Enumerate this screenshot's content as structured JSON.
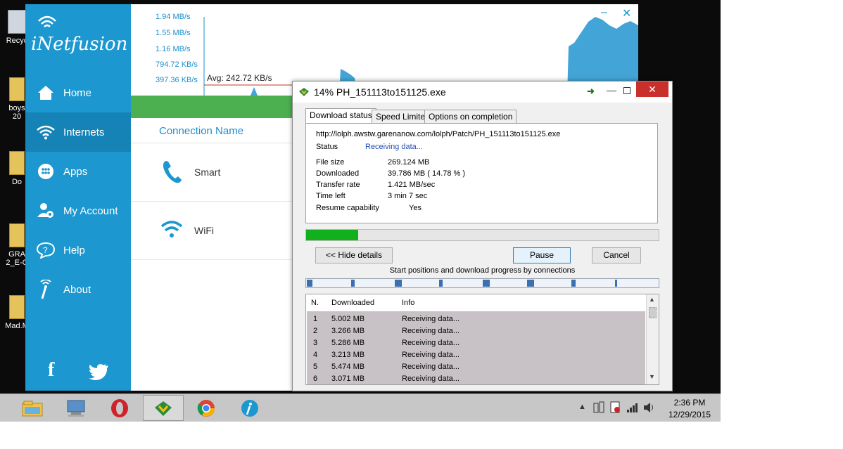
{
  "desktop": {
    "icons": [
      {
        "label": "Recyc",
        "type": "bin"
      },
      {
        "label": "boys\n20",
        "type": "folder"
      },
      {
        "label": "Do",
        "type": "folder"
      },
      {
        "label": "GRA\n2_E-C",
        "type": "folder"
      },
      {
        "label": "Mad.M",
        "type": "folder"
      }
    ]
  },
  "inetfusion": {
    "brand": "iNetfusion",
    "nav": [
      {
        "label": "Home",
        "icon": "home-icon"
      },
      {
        "label": "Internets",
        "icon": "wifi-icon",
        "active": true
      },
      {
        "label": "Apps",
        "icon": "apps-icon"
      },
      {
        "label": "My Account",
        "icon": "account-icon"
      },
      {
        "label": "Help",
        "icon": "help-icon"
      },
      {
        "label": "About",
        "icon": "about-icon"
      }
    ],
    "graph": {
      "y_ticks": [
        "1.94 MB/s",
        "1.55 MB/s",
        "1.16 MB/s",
        "794.72 KB/s",
        "397.36 KB/s"
      ],
      "avg_label": "Avg: 242.72 KB/s"
    },
    "controls": {
      "minimize": "–",
      "close": "✕"
    },
    "connection_header": "Connection Name",
    "connections": [
      {
        "label": "Smart",
        "icon": "phone-icon"
      },
      {
        "label": "WiFi",
        "icon": "wifi-icon"
      }
    ],
    "social": {
      "facebook": "f",
      "twitter": "twitter-icon"
    }
  },
  "idm": {
    "title": "14% PH_151113to151125.exe",
    "close_label": "✕",
    "tabs": [
      "Download status",
      "Speed Limiter",
      "Options on completion"
    ],
    "url": "http://lolph.awstw.garenanow.com/lolph/Patch/PH_151113to151125.exe",
    "status_label": "Status",
    "status_value": "Receiving data...",
    "fields": [
      {
        "label": "File size",
        "value": "269.124  MB"
      },
      {
        "label": "Downloaded",
        "value": "39.786  MB  ( 14.78 % )"
      },
      {
        "label": "Transfer rate",
        "value": "1.421  MB/sec"
      },
      {
        "label": "Time left",
        "value": "3 min 7 sec"
      },
      {
        "label": "Resume capability",
        "value": "Yes"
      }
    ],
    "progress": 0.1478,
    "buttons": {
      "hide_details": "<< Hide details",
      "pause": "Pause",
      "cancel": "Cancel"
    },
    "connections_caption": "Start positions and download progress by connections",
    "list_headers": {
      "n": "N.",
      "downloaded": "Downloaded",
      "info": "Info"
    },
    "list_rows": [
      {
        "n": "1",
        "downloaded": "5.002  MB",
        "info": "Receiving data..."
      },
      {
        "n": "2",
        "downloaded": "3.266  MB",
        "info": "Receiving data..."
      },
      {
        "n": "3",
        "downloaded": "5.286  MB",
        "info": "Receiving data..."
      },
      {
        "n": "4",
        "downloaded": "3.213  MB",
        "info": "Receiving data..."
      },
      {
        "n": "5",
        "downloaded": "5.474  MB",
        "info": "Receiving data..."
      },
      {
        "n": "6",
        "downloaded": "3.071  MB",
        "info": "Receiving data..."
      }
    ]
  },
  "taskbar": {
    "apps": [
      {
        "name": "file-explorer-icon"
      },
      {
        "name": "computer-icon"
      },
      {
        "name": "opera-icon"
      },
      {
        "name": "idm-icon",
        "active": true
      },
      {
        "name": "chrome-icon"
      },
      {
        "name": "inetfusion-icon"
      }
    ],
    "time": "2:36 PM",
    "date": "12/29/2015"
  },
  "colors": {
    "sidebar": "#1c97cf",
    "sidebar_active": "#1583b6",
    "accent": "#1c8fcb",
    "progress_green": "#11b01c",
    "close_red": "#c9302c"
  }
}
